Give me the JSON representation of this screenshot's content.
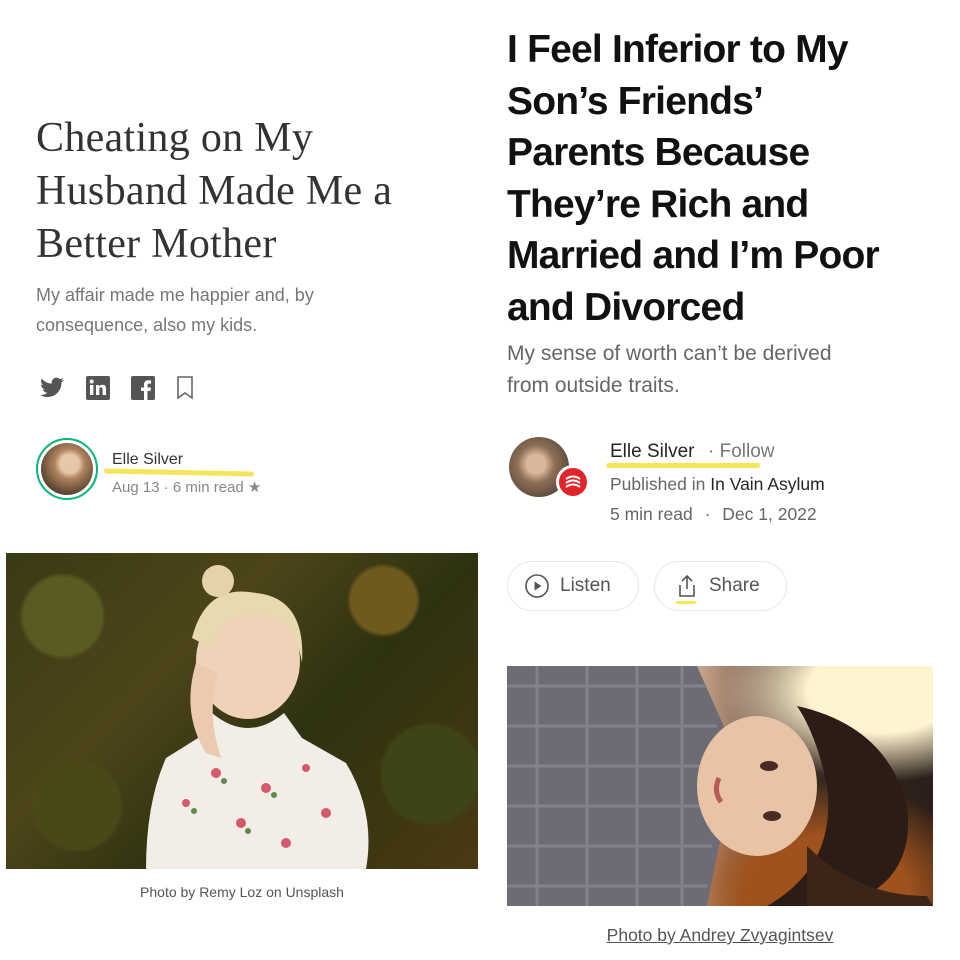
{
  "left_article": {
    "title_lines": [
      "Cheating on My",
      "Husband Made Me a",
      "Better Mother"
    ],
    "subtitle_lines": [
      "My affair made me happier and, by",
      "consequence, also my kids."
    ],
    "share_icons": [
      "twitter-icon",
      "linkedin-icon",
      "facebook-icon",
      "bookmark-icon"
    ],
    "author": "Elle Silver",
    "meta": "Aug 13 · 6 min read ★",
    "photo_caption": "Photo by Remy Loz on Unsplash"
  },
  "right_article": {
    "title_lines": [
      "I Feel Inferior to My",
      "Son’s Friends’",
      "Parents Because",
      "They’re Rich and",
      "Married and I’m Poor",
      "and Divorced"
    ],
    "subtitle_lines": [
      "My sense of worth can’t be derived",
      "from outside traits."
    ],
    "author": "Elle Silver",
    "follow_label": "· Follow",
    "published_in_prefix": "Published in",
    "publication": "In Vain Asylum",
    "read_time": "5 min read",
    "separator": "·",
    "date": "Dec 1, 2022",
    "listen_label": "Listen",
    "share_label": "Share",
    "photo_caption": "Photo by Andrey Zvyagintsev"
  },
  "colors": {
    "highlight": "#f4e24a",
    "avatar_ring": "#02b875",
    "publication_badge": "#e0242a"
  }
}
